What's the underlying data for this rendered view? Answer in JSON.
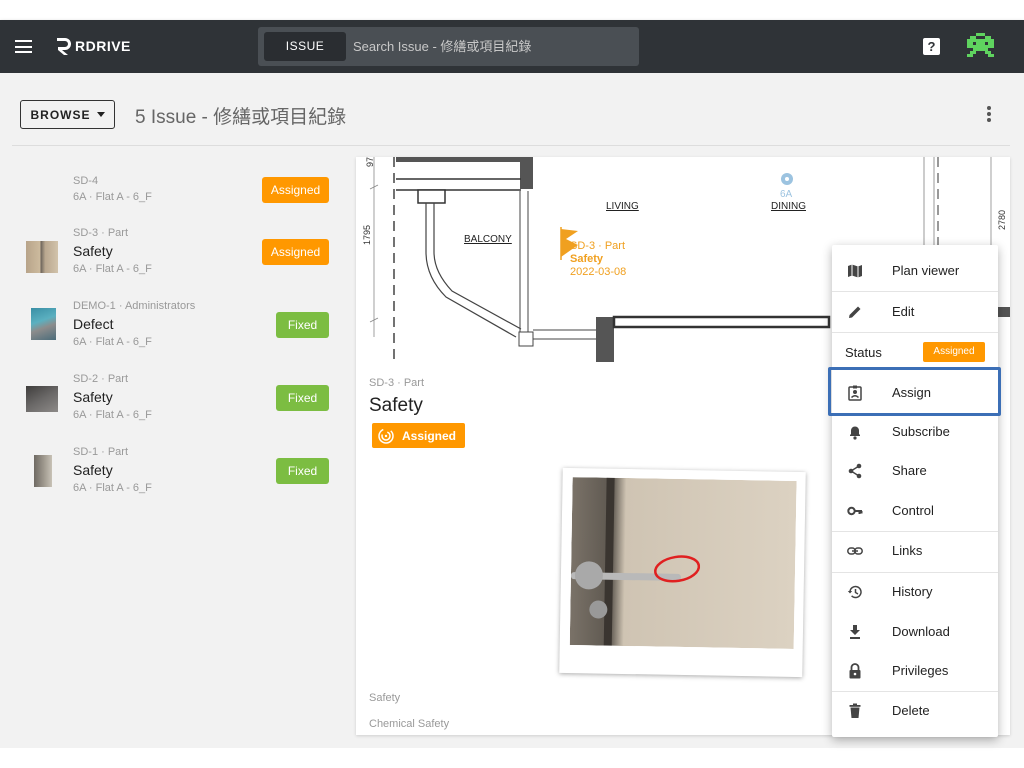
{
  "header": {
    "brand": "RDRIVE",
    "search_chip": "ISSUE",
    "search_placeholder": "Search Issue - 修繕或項目紀錄",
    "help": "?"
  },
  "toolbar": {
    "browse_label": "BROWSE",
    "page_title": "5 Issue - 修繕或項目紀錄"
  },
  "issues": [
    {
      "code": "SD-4",
      "title": "",
      "location": "6A · Flat A - 6_F",
      "status": "Assigned"
    },
    {
      "code": "SD-3 · Part",
      "title": "Safety",
      "location": "6A · Flat A - 6_F",
      "status": "Assigned"
    },
    {
      "code": "DEMO-1 · Administrators",
      "title": "Defect",
      "location": "6A · Flat A - 6_F",
      "status": "Fixed"
    },
    {
      "code": "SD-2 · Part",
      "title": "Safety",
      "location": "6A · Flat A - 6_F",
      "status": "Fixed"
    },
    {
      "code": "SD-1 · Part",
      "title": "Safety",
      "location": "6A · Flat A - 6_F",
      "status": "Fixed"
    }
  ],
  "plan": {
    "labels": {
      "living": "LIVING",
      "dining": "DINING",
      "balcony": "BALCONY",
      "unit": "6A"
    },
    "dims": {
      "d1": "1795",
      "d2": "2780",
      "d3": "97"
    },
    "marker": {
      "code": "SD-3 · Part",
      "title": "Safety",
      "date": "2022-03-08"
    }
  },
  "detail": {
    "code": "SD-3 · Part",
    "title": "Safety",
    "status": "Assigned",
    "category": "Safety",
    "subcategory": "Chemical Safety"
  },
  "menu": {
    "plan_viewer": "Plan viewer",
    "edit": "Edit",
    "status_label": "Status",
    "status_value": "Assigned",
    "assign": "Assign",
    "subscribe": "Subscribe",
    "share": "Share",
    "control": "Control",
    "links": "Links",
    "history": "History",
    "download": "Download",
    "privileges": "Privileges",
    "delete": "Delete"
  },
  "colors": {
    "appbar": "#2f3337",
    "assigned": "#ff9800",
    "fixed": "#7cbd42",
    "highlight": "#3c6fb6"
  }
}
